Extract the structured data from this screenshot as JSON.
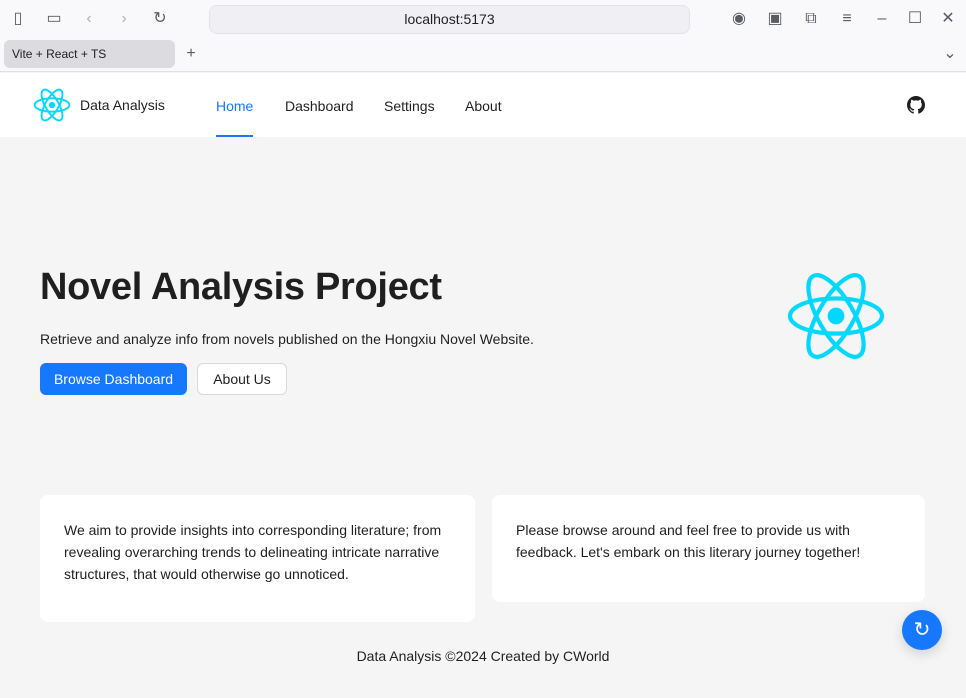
{
  "browser": {
    "url": "localhost:5173",
    "tab_title": "Vite + React + TS",
    "new_tab": "+"
  },
  "nav": {
    "brand": "Data Analysis",
    "items": [
      {
        "label": "Home",
        "active": true
      },
      {
        "label": "Dashboard"
      },
      {
        "label": "Settings"
      },
      {
        "label": "About"
      }
    ]
  },
  "hero": {
    "title": "Novel Analysis Project",
    "subtitle": "Retrieve and analyze info from novels published on the Hongxiu Novel Website.",
    "primary_button": "Browse Dashboard",
    "secondary_button": "About Us"
  },
  "cards": [
    "We aim to provide insights into corresponding literature; from revealing overarching trends to delineating intricate narrative structures, that would otherwise go unnoticed.",
    "Please browse around and feel free to provide us with feedback. Let's embark on this literary journey together!"
  ],
  "footer": "Data Analysis ©2024 Created by CWorld",
  "colors": {
    "accent": "#1677ff",
    "react": "#00d8ff"
  }
}
